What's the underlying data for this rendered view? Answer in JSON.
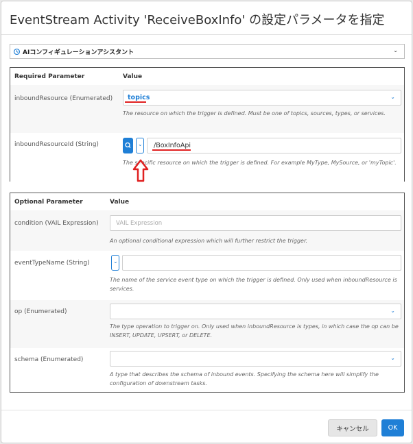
{
  "dialog": {
    "title": "EventStream Activity 'ReceiveBoxInfo' の設定パラメータを指定",
    "assistant_label": "AIコンフィギュレーションアシスタント",
    "cancel_label": "キャンセル",
    "ok_label": "OK"
  },
  "required": {
    "header_param": "Required Parameter",
    "header_value": "Value",
    "rows": [
      {
        "label": "inboundResource (Enumerated)",
        "value": "topics",
        "description": "The resource on which the trigger is defined. Must be one of topics, sources, types, or services."
      },
      {
        "label": "inboundResourceId (String)",
        "value": "/BoxInfoApi",
        "description": "The specific resource on which the trigger is defined. For example MyType, MySource, or 'myTopic'."
      }
    ]
  },
  "optional": {
    "header_param": "Optional Parameter",
    "header_value": "Value",
    "rows": [
      {
        "label": "condition (VAIL Expression)",
        "placeholder": "VAIL Expression",
        "description": "An optional conditional expression which will further restrict the trigger."
      },
      {
        "label": "eventTypeName (String)",
        "description": "The name of the service event type on which the trigger is defined. Only used when inboundResource is services."
      },
      {
        "label": "op (Enumerated)",
        "description": "The type operation to trigger on. Only used when inboundResource is types, in which case the op can be INSERT, UPDATE, UPSERT, or DELETE."
      },
      {
        "label": "schema (Enumerated)",
        "description": "A type that describes the schema of inbound events. Specifying the schema here will simplify the configuration of downstream tasks."
      }
    ]
  },
  "colors": {
    "accent": "#1f7fd6",
    "annotation": "#e02020"
  }
}
